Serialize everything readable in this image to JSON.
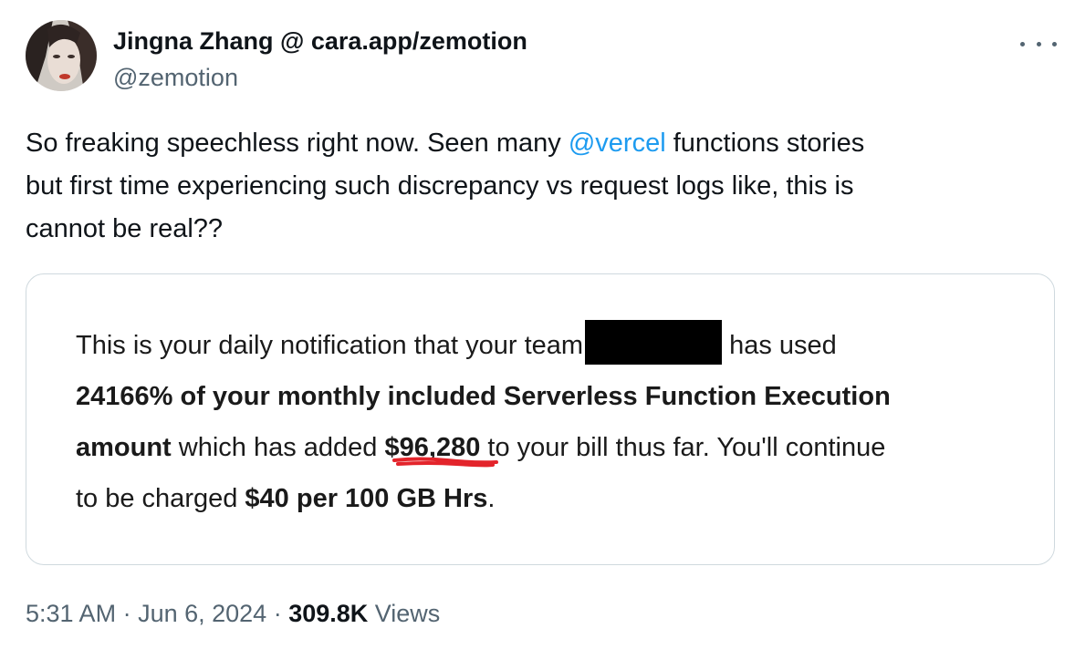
{
  "author": {
    "display_name": "Jingna Zhang @ cara.app/zemotion",
    "handle": "@zemotion",
    "avatar_icon": "profile-photo"
  },
  "tweet": {
    "text_line1_a": "So freaking speechless right now. Seen many ",
    "mention": "@vercel",
    "text_line1_b": " functions stories",
    "text_line2": "but first time experiencing such discrepancy vs request logs like, this is",
    "text_line3": "cannot be real??"
  },
  "email_image": {
    "line1_a": "This is your daily notification that your team",
    "line1_b": "has used",
    "line2_bold": "24166% of your monthly included Serverless Function Execution",
    "line3_bold_a": "amount",
    "line3_b": " which has added ",
    "line3_bold_amount": "$96,280",
    "line3_c": " to your bill thus far. You'll continue",
    "line4_a": "to be charged ",
    "line4_bold": "$40 per 100 GB Hrs",
    "line4_b": ".",
    "underline_color": "#e3242b",
    "redaction_color": "#000000"
  },
  "meta": {
    "time": "5:31 AM",
    "sep1": " · ",
    "date": "Jun 6, 2024",
    "sep2": " · ",
    "views_count": "309.8K",
    "views_label": " Views"
  },
  "colors": {
    "link": "#1d9bf0",
    "secondary_text": "#536471",
    "primary_text": "#0f1419",
    "card_border": "#cfd9de"
  }
}
